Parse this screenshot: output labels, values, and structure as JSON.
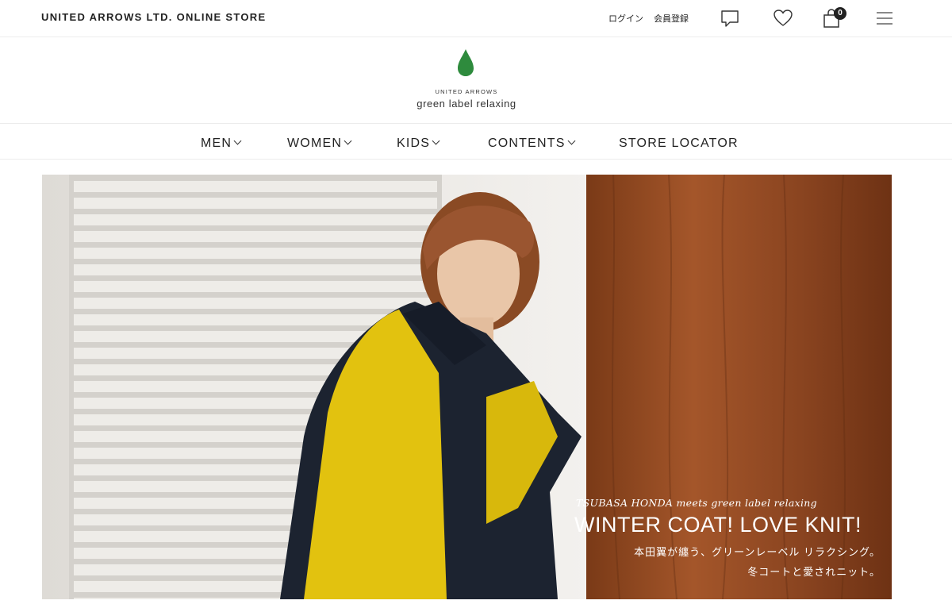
{
  "header": {
    "store_name": "UNITED ARROWS LTD. ONLINE STORE",
    "login_label": "ログイン",
    "register_label": "会員登録",
    "cart_count": "0",
    "icons": [
      "chat-icon",
      "heart-icon",
      "cart-icon",
      "menu-icon"
    ]
  },
  "brand": {
    "top": "UNITED ARROWS",
    "name": "green label relaxing",
    "color": "#2e8b3d"
  },
  "nav": {
    "items": [
      {
        "label": "MEN",
        "has_dropdown": true
      },
      {
        "label": "WOMEN",
        "has_dropdown": true
      },
      {
        "label": "KIDS",
        "has_dropdown": true
      },
      {
        "label": "CONTENTS",
        "has_dropdown": true
      },
      {
        "label": "STORE LOCATOR",
        "has_dropdown": false
      }
    ]
  },
  "hero": {
    "subtitle": "TSUBASA HONDA meets green label relaxing",
    "title": "WINTER COAT! LOVE KNIT!",
    "jp_line1": "本田翼が纏う、グリーンレーベル リラクシング。",
    "jp_line2": "冬コートと愛されニット。"
  }
}
